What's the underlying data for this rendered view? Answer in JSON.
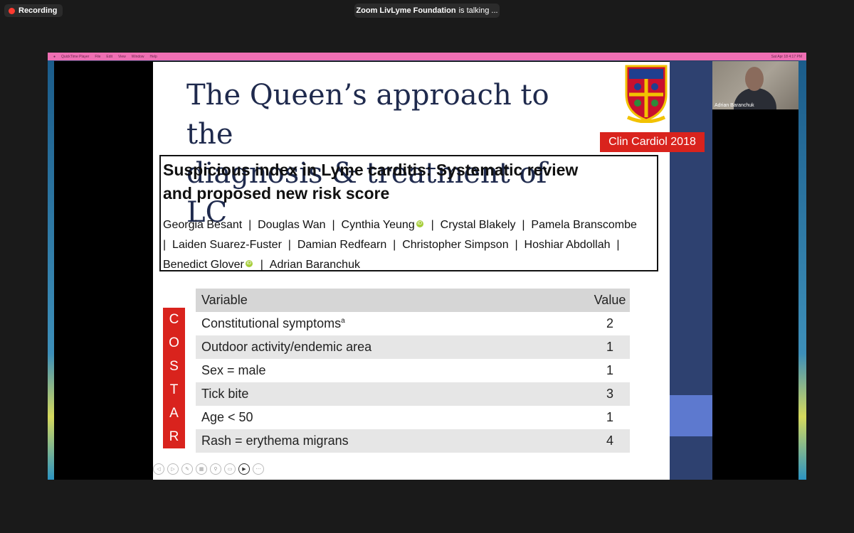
{
  "zoom": {
    "recording_label": "Recording",
    "talking": {
      "name": "Zoom LivLyme Foundation",
      "suffix": "is talking ..."
    },
    "participant_name": "Adrian Baranchuk"
  },
  "mac_menu": {
    "app": "QuickTime Player",
    "items": [
      "File",
      "Edit",
      "View",
      "Window",
      "Help"
    ],
    "clock": "Sat Apr 18 4:17 PM"
  },
  "slide": {
    "title_line1": "The Queen’s approach to the",
    "title_line2": "diagnosis & treatment of LC",
    "citation": "Clin Cardiol 2018",
    "paper_title_line1": "Suspicious index in Lyme carditis: Systematic review",
    "paper_title_line2": "and proposed new risk score",
    "authors": [
      "Georgia Besant",
      "Douglas Wan",
      "Cynthia Yeung",
      "Crystal Blakely",
      "Pamela Branscombe",
      "Laiden Suarez-Fuster",
      "Damian Redfearn",
      "Christopher Simpson",
      "Hoshiar Abdollah",
      "Benedict Glover",
      "Adrian Baranchuk"
    ],
    "costar_letters": [
      "C",
      "O",
      "S",
      "T",
      "A",
      "R"
    ],
    "table": {
      "header": {
        "variable": "Variable",
        "value": "Value"
      },
      "rows": [
        {
          "variable": "Constitutional symptoms",
          "note": "a",
          "value": "2"
        },
        {
          "variable": "Outdoor activity/endemic area",
          "value": "1"
        },
        {
          "variable": "Sex = male",
          "value": "1"
        },
        {
          "variable": "Tick bite",
          "value": "3"
        },
        {
          "variable": "Age < 50",
          "value": "1"
        },
        {
          "variable": "Rash = erythema migrans",
          "value": "4"
        }
      ]
    }
  },
  "colors": {
    "accent_red": "#d9231d",
    "title_navy": "#1f2a4d",
    "mac_menu_pink": "#ef6fb3"
  }
}
